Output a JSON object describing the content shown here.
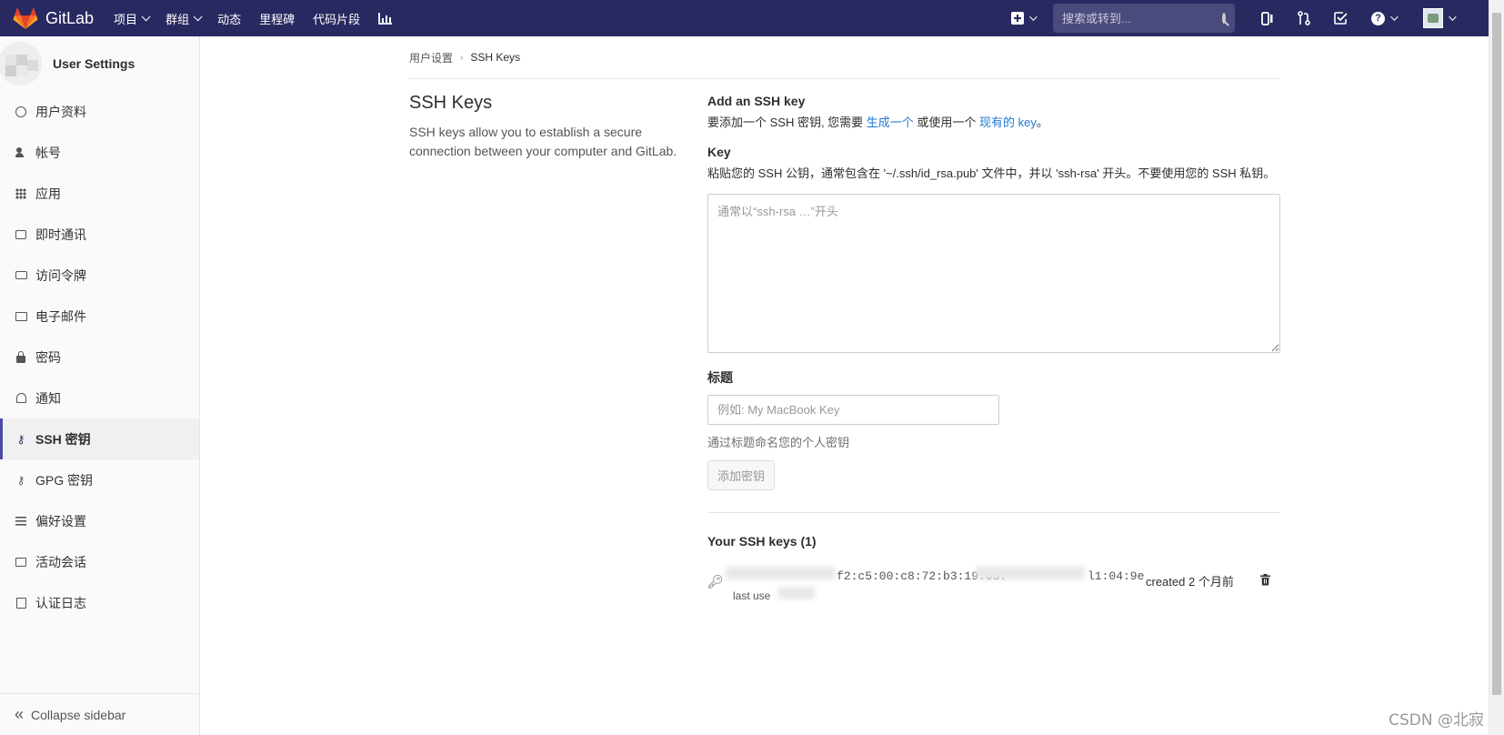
{
  "navbar": {
    "brand": "GitLab",
    "links": [
      {
        "label": "项目",
        "dropdown": true
      },
      {
        "label": "群组",
        "dropdown": true
      },
      {
        "label": "动态",
        "dropdown": false
      },
      {
        "label": "里程碑",
        "dropdown": false
      },
      {
        "label": "代码片段",
        "dropdown": false
      }
    ],
    "search_placeholder": "搜索或转到...",
    "help_glyph": "?"
  },
  "sidebar": {
    "title": "User Settings",
    "items": [
      {
        "label": "用户资料",
        "icon": "profile-icon"
      },
      {
        "label": "帐号",
        "icon": "account-icon"
      },
      {
        "label": "应用",
        "icon": "applications-icon"
      },
      {
        "label": "即时通讯",
        "icon": "chat-icon"
      },
      {
        "label": "访问令牌",
        "icon": "token-icon"
      },
      {
        "label": "电子邮件",
        "icon": "mail-icon"
      },
      {
        "label": "密码",
        "icon": "lock-icon"
      },
      {
        "label": "通知",
        "icon": "bell-icon"
      },
      {
        "label": "SSH 密钥",
        "icon": "key-icon",
        "active": true
      },
      {
        "label": "GPG 密钥",
        "icon": "key-icon"
      },
      {
        "label": "偏好设置",
        "icon": "sliders-icon"
      },
      {
        "label": "活动会话",
        "icon": "monitor-icon"
      },
      {
        "label": "认证日志",
        "icon": "log-icon"
      }
    ],
    "collapse_label": "Collapse sidebar"
  },
  "breadcrumb": {
    "parent": "用户设置",
    "current": "SSH Keys"
  },
  "intro": {
    "title": "SSH Keys",
    "description": "SSH keys allow you to establish a secure connection between your computer and GitLab."
  },
  "add_key": {
    "heading": "Add an SSH key",
    "intro_prefix": "要添加一个 SSH 密钥, 您需要 ",
    "intro_link1": "生成一个",
    "intro_middle": " 或使用一个 ",
    "intro_link2": "现有的 key",
    "intro_suffix": "。",
    "key_label": "Key",
    "key_help": "粘贴您的 SSH 公钥，通常包含在 '~/.ssh/id_rsa.pub' 文件中，并以 'ssh-rsa' 开头。不要使用您的 SSH 私钥。",
    "key_placeholder": "通常以“ssh-rsa …”开头",
    "title_label": "标题",
    "title_placeholder": "例如: My MacBook Key",
    "title_help": "通过标题命名您的个人密钥",
    "submit_label": "添加密钥"
  },
  "your_keys": {
    "heading": "Your SSH keys (1)",
    "keys": [
      {
        "fingerprint": "f2:c5:00:c8:72:b3:19:65:",
        "fingerprint_tail": "l1:04:9e",
        "last_used": "last use",
        "created": "created 2 个月前"
      }
    ]
  },
  "watermark": "CSDN @北寂",
  "colors": {
    "navbar": "#292961",
    "link": "#1f78d1",
    "active_indicator": "#4b4ba3"
  }
}
